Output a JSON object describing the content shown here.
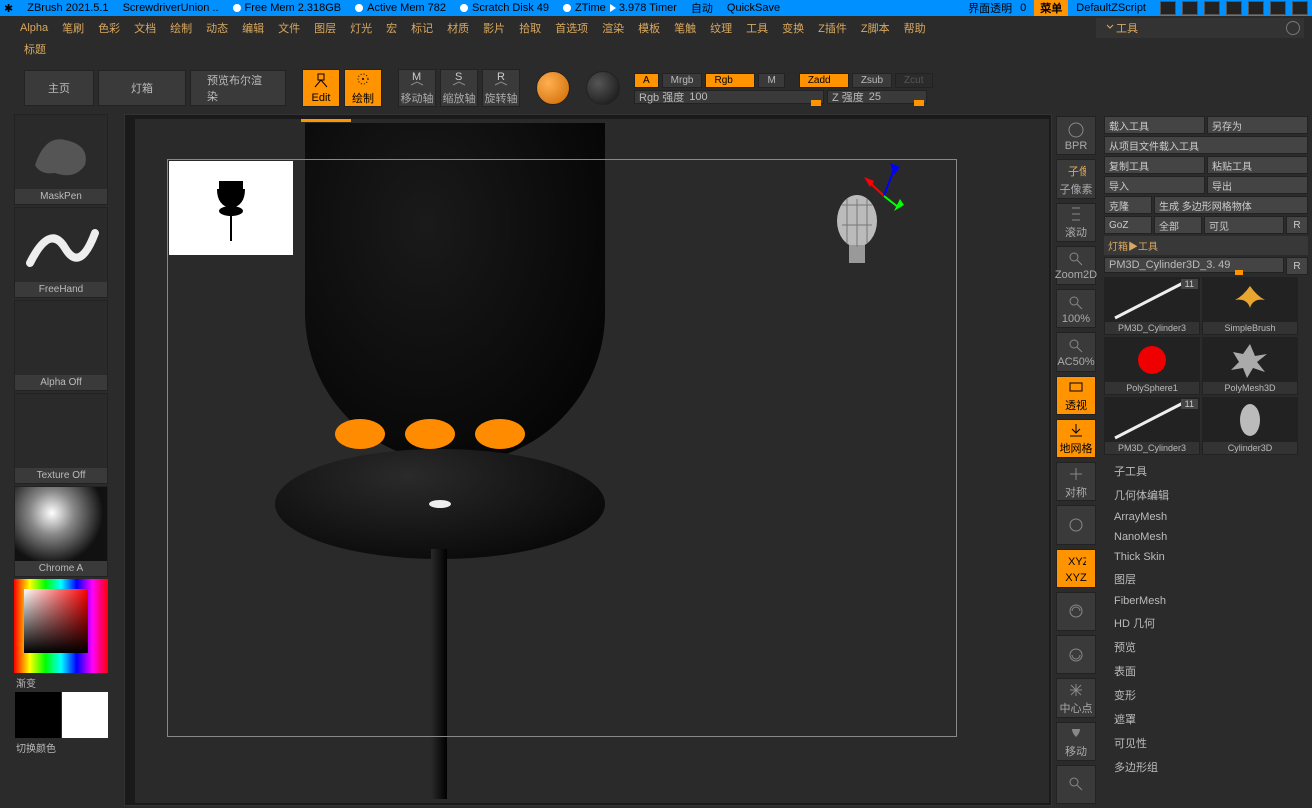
{
  "titlebar": {
    "app": "ZBrush 2021.5.1",
    "project": "ScrewdriverUnion  ..",
    "freemem": "Free Mem 2.318GB",
    "activemem": "Active Mem 782",
    "scratch": "Scratch Disk 49",
    "ztime": "ZTime",
    "timer": "3.978 Timer",
    "auto": "自动",
    "quicksave": "QuickSave",
    "opacity_label": "界面透明",
    "opacity_val": "0",
    "menu": "菜单",
    "script": "DefaultZScript"
  },
  "mainmenu": [
    "Alpha",
    "笔刷",
    "色彩",
    "文档",
    "绘制",
    "动态",
    "编辑",
    "文件",
    "图层",
    "灯光",
    "宏",
    "标记",
    "材质",
    "影片",
    "拾取",
    "首选项",
    "渲染",
    "模板",
    "笔触",
    "纹理",
    "工具",
    "变换",
    "Z插件",
    "Z脚本",
    "帮助"
  ],
  "toolpanel_title": "工具",
  "subtitle": "标题",
  "toolbar": {
    "home": "主页",
    "lightbox": "灯箱",
    "preview": "预览布尔渲染",
    "edit": "Edit",
    "draw": "绘制",
    "move": "移动轴",
    "scale": "缩放轴",
    "rotate": "旋转轴"
  },
  "sliders": {
    "a": "A",
    "mrgb": "Mrgb",
    "rgb": "Rgb",
    "m": "M",
    "zadd": "Zadd",
    "zsub": "Zsub",
    "zcut": "Zcut",
    "rgb_label": "Rgb 强度",
    "rgb_val": "100",
    "z_label": "Z 强度",
    "z_val": "25"
  },
  "left": {
    "brush": "MaskPen",
    "stroke": "FreeHand",
    "alpha": "Alpha Off",
    "texture": "Texture Off",
    "material": "Chrome A",
    "grad": "渐变",
    "swap": "切换颜色"
  },
  "rightbtns": [
    "BPR",
    "子像素",
    "滚动",
    "Zoom2D",
    "100%",
    "AC50%",
    "透视",
    "地网格",
    "对称",
    "",
    "XYZ",
    "",
    "",
    "中心点",
    "移动",
    ""
  ],
  "rightbtns_active": [
    false,
    false,
    false,
    false,
    false,
    false,
    true,
    true,
    false,
    false,
    true,
    false,
    false,
    false,
    false,
    false
  ],
  "rpanel": {
    "load_tool": "载入工具",
    "save_as": "另存为",
    "load_proj": "从项目文件载入工具",
    "copy": "复制工具",
    "paste": "粘贴工具",
    "import": "导入",
    "export": "导出",
    "clone": "克隆",
    "gen_mesh": "生成 多边形网格物体",
    "goz": "GoZ",
    "all": "全部",
    "visible": "可见",
    "r": "R",
    "light_tool": "灯箱▶工具",
    "current": "PM3D_Cylinder3D_3.",
    "current_v": "49",
    "tools": [
      {
        "name": "PM3D_Cylinder3",
        "badge": "11"
      },
      {
        "name": "SimpleBrush",
        "badge": ""
      },
      {
        "name": "PolySphere1",
        "badge": ""
      },
      {
        "name": "PolyMesh3D",
        "badge": ""
      },
      {
        "name": "PM3D_Cylinder3",
        "badge": "11"
      },
      {
        "name": "Cylinder3D",
        "badge": ""
      }
    ],
    "props": [
      "子工具",
      "几何体编辑",
      "ArrayMesh",
      "NanoMesh",
      "Thick Skin",
      "图层",
      "FiberMesh",
      "HD 几何",
      "预览",
      "表面",
      "变形",
      "遮罩",
      "可见性",
      "多边形组"
    ]
  }
}
